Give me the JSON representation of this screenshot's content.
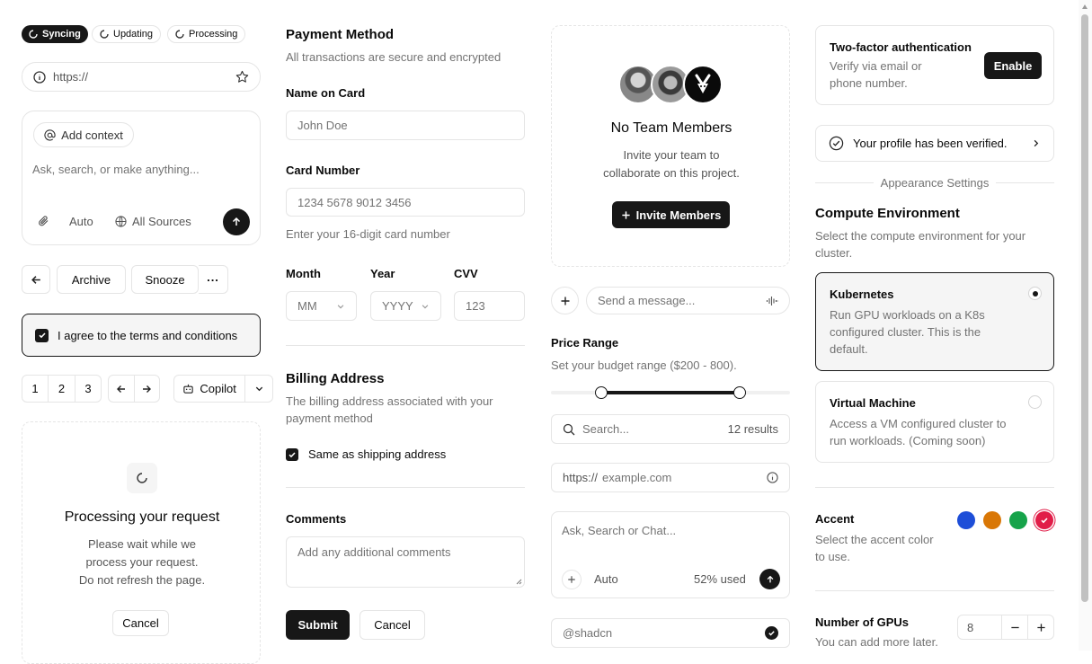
{
  "col1": {
    "badges": [
      "Syncing",
      "Updating",
      "Processing"
    ],
    "url_prefix": "https://",
    "prompt": {
      "context_label": "Add context",
      "placeholder": "Ask, search, or make anything...",
      "mode": "Auto",
      "sources": "All Sources"
    },
    "actions": {
      "archive": "Archive",
      "snooze": "Snooze"
    },
    "terms": "I agree to the terms and conditions",
    "pages": [
      "1",
      "2",
      "3"
    ],
    "copilot": "Copilot",
    "processing": {
      "title": "Processing your request",
      "line1": "Please wait while we",
      "line2": "process your request.",
      "line3": "Do not refresh the page.",
      "cancel": "Cancel"
    }
  },
  "col2": {
    "payment_title": "Payment Method",
    "payment_sub": "All transactions are secure and encrypted",
    "name_label": "Name on Card",
    "name_placeholder": "John Doe",
    "card_label": "Card Number",
    "card_placeholder": "1234 5678 9012 3456",
    "card_help": "Enter your 16-digit card number",
    "month_label": "Month",
    "month_placeholder": "MM",
    "year_label": "Year",
    "year_placeholder": "YYYY",
    "cvv_label": "CVV",
    "cvv_placeholder": "123",
    "billing_title": "Billing Address",
    "billing_sub1": "The billing address associated with your",
    "billing_sub2": "payment method",
    "same_shipping": "Same as shipping address",
    "comments_label": "Comments",
    "comments_placeholder": "Add any additional comments",
    "submit": "Submit",
    "cancel": "Cancel"
  },
  "col3": {
    "team": {
      "title": "No Team Members",
      "sub1": "Invite your team to",
      "sub2": "collaborate on this project.",
      "invite": "Invite Members"
    },
    "message_placeholder": "Send a message...",
    "price": {
      "title": "Price Range",
      "sub": "Set your budget range ($200 - 800).",
      "low_fraction": 0.21,
      "high_fraction": 0.79
    },
    "search_placeholder": "Search...",
    "search_results": "12 results",
    "url_prefix": "https://",
    "url_placeholder": "example.com",
    "chat_placeholder": "Ask, Search or Chat...",
    "chat_mode": "Auto",
    "chat_usage": "52% used",
    "username": "@shadcn"
  },
  "col4": {
    "twofa_title": "Two-factor authentication",
    "twofa_sub1": "Verify via email or",
    "twofa_sub2": "phone number.",
    "enable": "Enable",
    "verified": "Your profile has been verified.",
    "appearance": "Appearance Settings",
    "compute_title": "Compute Environment",
    "compute_sub1": "Select the compute environment for your",
    "compute_sub2": "cluster.",
    "k8s_title": "Kubernetes",
    "k8s_l1": "Run GPU workloads on a K8s",
    "k8s_l2": "configured cluster. This is the",
    "k8s_l3": "default.",
    "vm_title": "Virtual Machine",
    "vm_l1": "Access a VM configured cluster to",
    "vm_l2": "run workloads. (Coming soon)",
    "accent_title": "Accent",
    "accent_sub1": "Select the accent color",
    "accent_sub2": "to use.",
    "accent_colors": [
      "#1d4ed8",
      "#d97706",
      "#16a34a",
      "#e11d48"
    ],
    "gpu_title": "Number of GPUs",
    "gpu_sub": "You can add more later.",
    "gpu_value": "8"
  }
}
